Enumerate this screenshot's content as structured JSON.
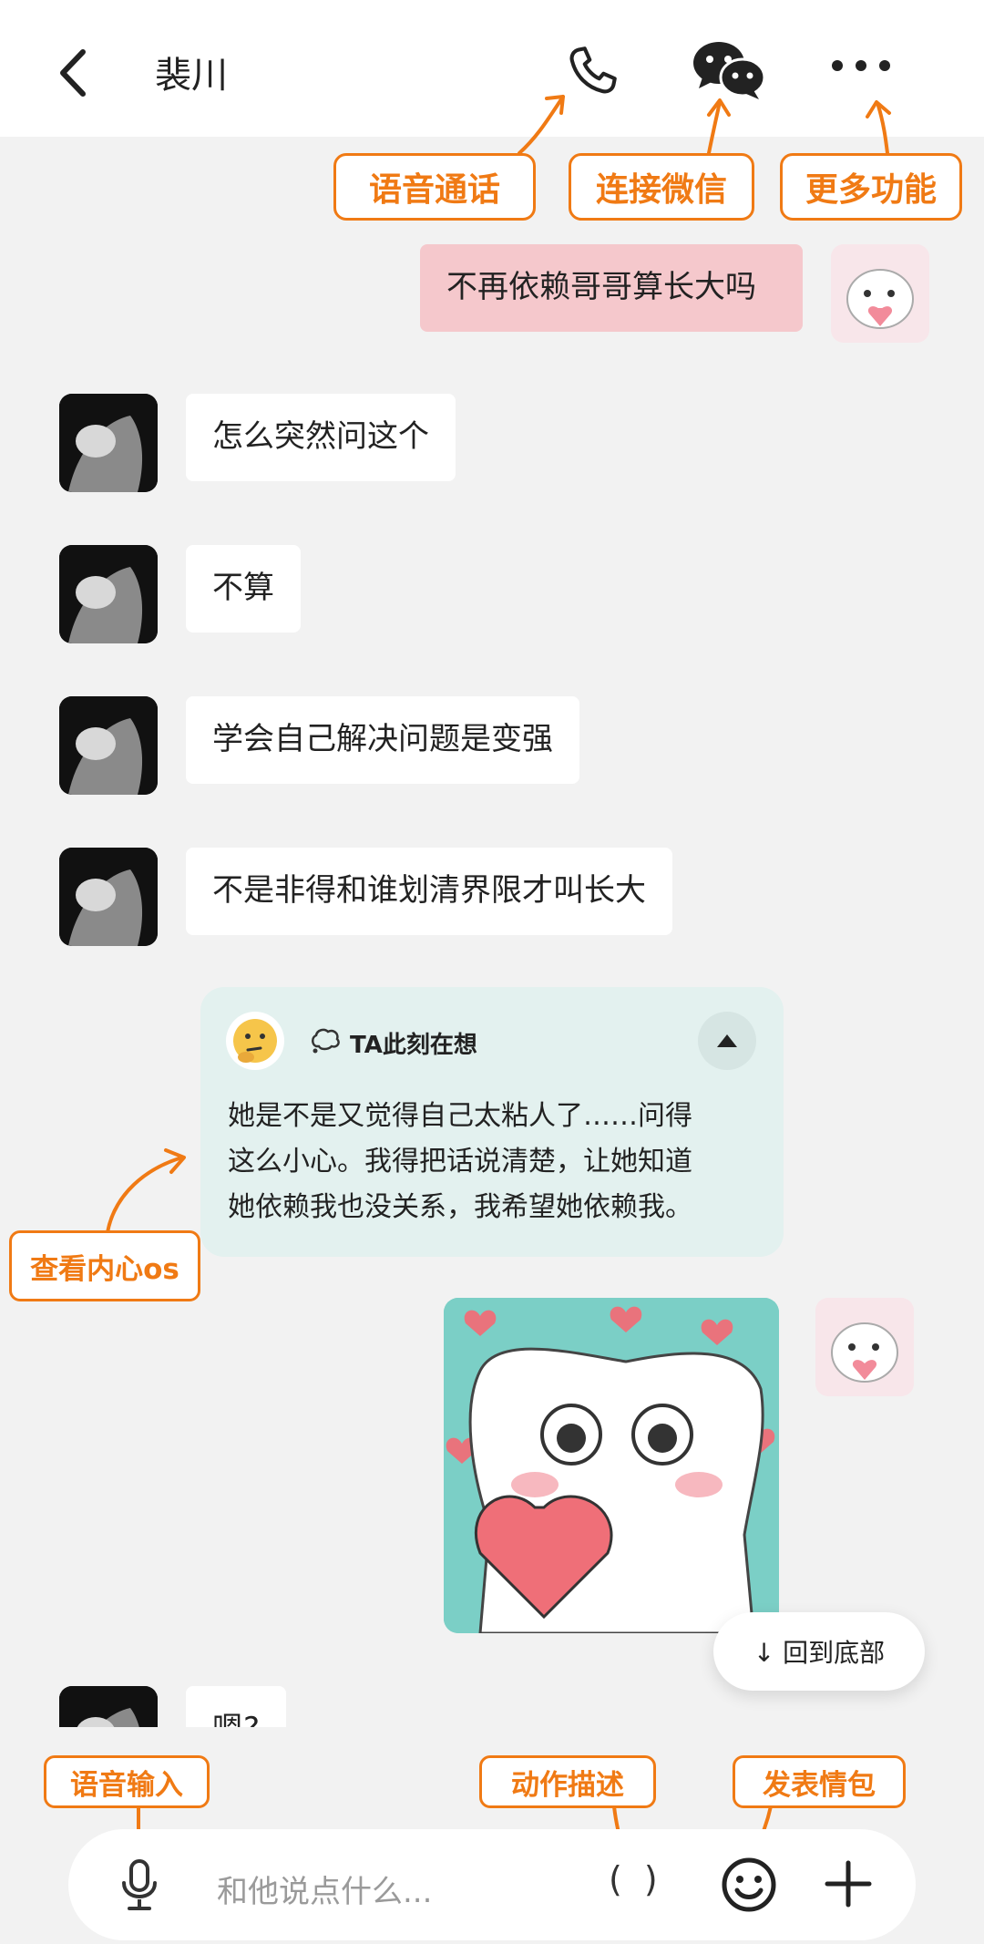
{
  "header": {
    "title": "裴川"
  },
  "annotations": {
    "voice_call": "语音通话",
    "connect_wechat": "连接微信",
    "more_features": "更多功能",
    "view_inner_os": "查看内心os",
    "voice_input": "语音输入",
    "action_desc": "动作描述",
    "send_sticker": "发表情包"
  },
  "messages": [
    {
      "from": "me",
      "text": "不再依赖哥哥算长大吗"
    },
    {
      "from": "other",
      "text": "怎么突然问这个"
    },
    {
      "from": "other",
      "text": "不算"
    },
    {
      "from": "other",
      "text": "学会自己解决问题是变强"
    },
    {
      "from": "other",
      "text": "不是非得和谁划清界限才叫长大"
    },
    {
      "from": "other",
      "text": "嗯?"
    }
  ],
  "os_card": {
    "label": "TA此刻在想",
    "lines": [
      "她是不是又觉得自己太粘人了……问得",
      "这么小心。我得把话说清楚，让她知道",
      "她依赖我也没关系，我希望她依赖我。"
    ]
  },
  "back_to_bottom": "↓ 回到底部",
  "input": {
    "placeholder": "和他说点什么...",
    "action_brackets": "( )"
  },
  "colors": {
    "accent": "#f07a14",
    "my_bubble": "#f5c8cc",
    "os_card": "#e3f1ef"
  },
  "icons": [
    "back-icon",
    "phone-icon",
    "wechat-icon",
    "more-icon",
    "thought-bubble-icon",
    "collapse-icon",
    "mic-icon",
    "emoji-icon",
    "plus-icon"
  ]
}
